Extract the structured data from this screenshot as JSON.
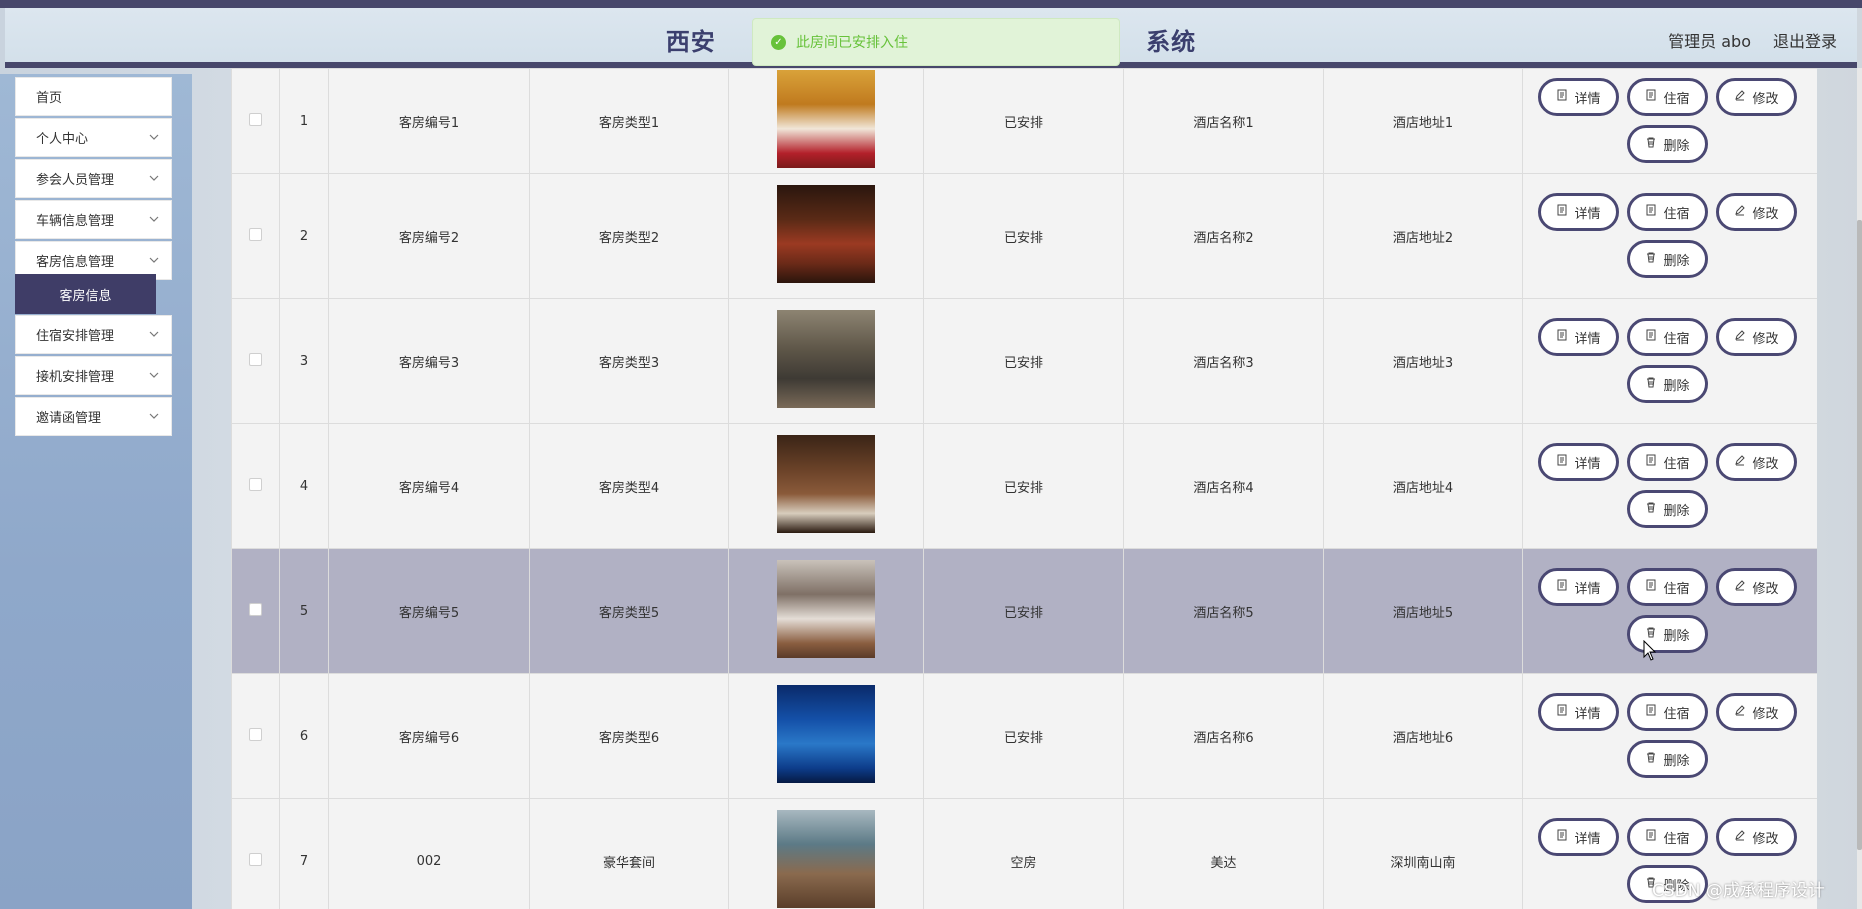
{
  "header": {
    "title": "西安                                              系统",
    "admin": "管理员 abo",
    "logout": "退出登录"
  },
  "toast": {
    "text": "此房间已安排入住",
    "icon": "check-circle-icon",
    "color": "#67c23a"
  },
  "sidebar": {
    "items": [
      {
        "label": "首页"
      },
      {
        "label": "个人中心"
      },
      {
        "label": "参会人员管理"
      },
      {
        "label": "车辆信息管理"
      },
      {
        "label": "客房信息管理"
      },
      {
        "label": "住宿安排管理"
      },
      {
        "label": "接机安排管理"
      },
      {
        "label": "邀请函管理"
      }
    ],
    "active_sub": "客房信息"
  },
  "table": {
    "rows": [
      {
        "index": "1",
        "room_no": "客房编号1",
        "room_type": "客房类型1",
        "status": "已安排",
        "hotel": "酒店名称1",
        "address": "酒店地址1"
      },
      {
        "index": "2",
        "room_no": "客房编号2",
        "room_type": "客房类型2",
        "status": "已安排",
        "hotel": "酒店名称2",
        "address": "酒店地址2"
      },
      {
        "index": "3",
        "room_no": "客房编号3",
        "room_type": "客房类型3",
        "status": "已安排",
        "hotel": "酒店名称3",
        "address": "酒店地址3"
      },
      {
        "index": "4",
        "room_no": "客房编号4",
        "room_type": "客房类型4",
        "status": "已安排",
        "hotel": "酒店名称4",
        "address": "酒店地址4"
      },
      {
        "index": "5",
        "room_no": "客房编号5",
        "room_type": "客房类型5",
        "status": "已安排",
        "hotel": "酒店名称5",
        "address": "酒店地址5"
      },
      {
        "index": "6",
        "room_no": "客房编号6",
        "room_type": "客房类型6",
        "status": "已安排",
        "hotel": "酒店名称6",
        "address": "酒店地址6"
      },
      {
        "index": "7",
        "room_no": "002",
        "room_type": "豪华套间",
        "status": "空房",
        "hotel": "美达",
        "address": "深圳南山南"
      }
    ],
    "actions": {
      "detail": "详情",
      "stay": "住宿",
      "edit": "修改",
      "delete": "删除"
    }
  },
  "watermark": "CSDN @成承程序设计",
  "colors": {
    "accent": "#47476b",
    "highlight_row": "#b1b1c4",
    "button_border": "#4a4873"
  }
}
